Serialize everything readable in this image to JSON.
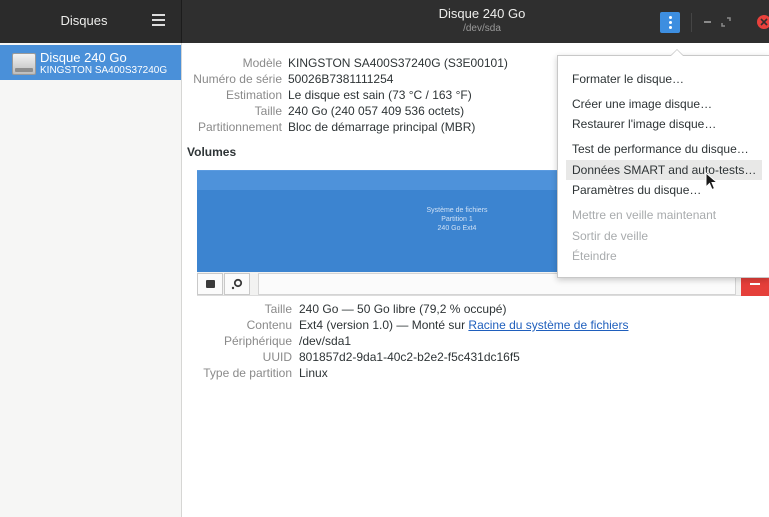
{
  "sidebar": {
    "title": "Disques",
    "items": [
      {
        "name": "Disque 240 Go",
        "model": "KINGSTON SA400S37240G"
      }
    ]
  },
  "header": {
    "title": "Disque 240 Go",
    "subtitle": "/dev/sda"
  },
  "disk_info": [
    {
      "label": "Modèle",
      "value": "KINGSTON SA400S37240G (S3E00101)"
    },
    {
      "label": "Numéro de série",
      "value": "50026B7381111254"
    },
    {
      "label": "Estimation",
      "value": "Le disque est sain (73 °C / 163 °F)"
    },
    {
      "label": "Taille",
      "value": "240 Go (240 057 409 536 octets)"
    },
    {
      "label": "Partitionnement",
      "value": "Bloc de démarrage principal (MBR)"
    }
  ],
  "volumes": {
    "heading": "Volumes",
    "partition_lines": [
      "Système de fichiers",
      "Partition 1",
      "240 Go Ext4"
    ]
  },
  "partition_info": {
    "size_label": "Taille",
    "size_value": "240 Go — 50 Go libre (79,2 % occupé)",
    "content_label": "Contenu",
    "content_prefix": "Ext4 (version 1.0) — Monté sur ",
    "content_link": "Racine du système de fichiers",
    "device_label": "Périphérique",
    "device_value": "/dev/sda1",
    "uuid_label": "UUID",
    "uuid_value": "801857d2-9da1-40c2-b2e2-f5c431dc16f5",
    "type_label": "Type de partition",
    "type_value": "Linux"
  },
  "menu": {
    "items": [
      {
        "label": "Formater le disque…",
        "enabled": true
      },
      {
        "label": "Créer une image disque…",
        "enabled": true
      },
      {
        "label": "Restaurer l'image disque…",
        "enabled": true
      },
      {
        "label": "Test de performance du disque…",
        "enabled": true
      },
      {
        "label": "Données SMART and auto-tests…",
        "enabled": true,
        "hovered": true
      },
      {
        "label": "Paramètres du disque…",
        "enabled": true
      },
      {
        "label": "Mettre en veille maintenant",
        "enabled": false
      },
      {
        "label": "Sortir de veille",
        "enabled": false
      },
      {
        "label": "Éteindre",
        "enabled": false
      }
    ]
  },
  "colors": {
    "accent": "#4a90d9",
    "partition_fill": "#3c84d0",
    "destructive": "#e53f3a"
  }
}
